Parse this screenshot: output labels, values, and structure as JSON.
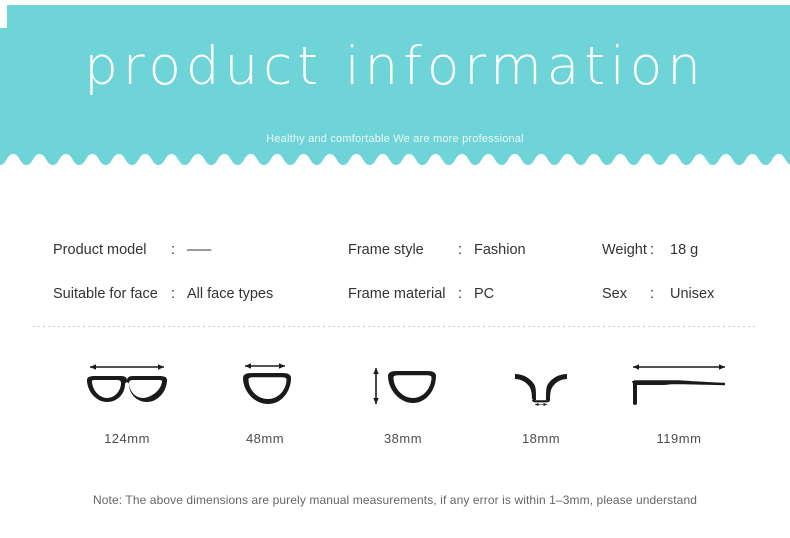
{
  "theme": {
    "accent": "#6fd4d8",
    "title_color": "#ffffff",
    "subtitle_color": "#eaf9fa",
    "text_color": "#333333",
    "muted_color": "#666666",
    "icon_color": "#1a1a1a",
    "divider_color": "#cccccc",
    "background": "#ffffff"
  },
  "header": {
    "title": "product information",
    "subtitle": "Healthy and comfortable We are more professional"
  },
  "specs": {
    "rows": [
      {
        "cells": [
          {
            "label": "Product model",
            "colon": ":",
            "value": "–––"
          },
          {
            "label": "Frame style",
            "colon": ":",
            "value": "Fashion"
          },
          {
            "label": "Weight",
            "colon": ":",
            "value": "18 g"
          }
        ]
      },
      {
        "cells": [
          {
            "label": "Suitable for face",
            "colon": ":",
            "value": "All face types"
          },
          {
            "label": "Frame material",
            "colon": ":",
            "value": "PC"
          },
          {
            "label": "Sex",
            "colon": ":",
            "value": "Unisex"
          }
        ]
      }
    ]
  },
  "dimensions": {
    "items": [
      {
        "icon": "full-frame-width-icon",
        "label": "124mm",
        "measure": "total frame width",
        "arrow": "horizontal-top"
      },
      {
        "icon": "lens-width-icon",
        "label": "48mm",
        "measure": "lens width",
        "arrow": "horizontal-top"
      },
      {
        "icon": "lens-height-icon",
        "label": "38mm",
        "measure": "lens height",
        "arrow": "vertical-left"
      },
      {
        "icon": "bridge-width-icon",
        "label": "18mm",
        "measure": "bridge width",
        "arrow": "horizontal-bottom"
      },
      {
        "icon": "temple-length-icon",
        "label": "119mm",
        "measure": "temple length",
        "arrow": "horizontal-top"
      }
    ]
  },
  "note": {
    "text": "Note: The above dimensions are purely manual measurements, if any error is within 1–3mm, please understand"
  }
}
